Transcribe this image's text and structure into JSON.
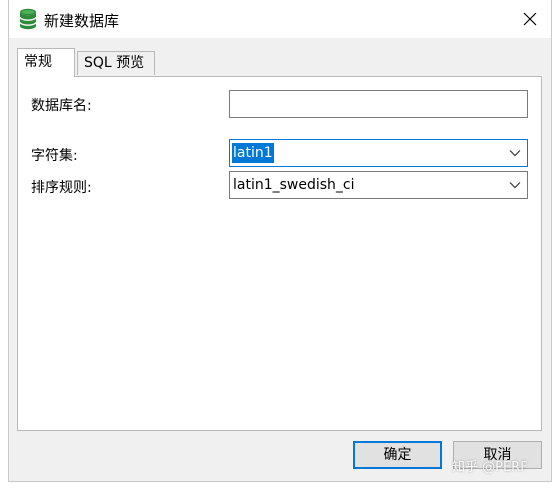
{
  "window": {
    "title": "新建数据库"
  },
  "tabs": [
    {
      "label": "常规",
      "active": true
    },
    {
      "label": "SQL 预览",
      "active": false
    }
  ],
  "form": {
    "db_name": {
      "label": "数据库名:",
      "value": ""
    },
    "charset": {
      "label": "字符集:",
      "value": "latin1"
    },
    "collation": {
      "label": "排序规则:",
      "value": "latin1_swedish_ci"
    }
  },
  "buttons": {
    "ok": "确定",
    "cancel": "取消"
  },
  "watermark": "知乎 @PERF",
  "colors": {
    "accent": "#0078d7",
    "db_icon": "#2e8b3a",
    "chrome": "#f0f0f0"
  },
  "icons": {
    "app": "database-icon",
    "close": "close-icon",
    "dropdown": "chevron-down-icon"
  }
}
